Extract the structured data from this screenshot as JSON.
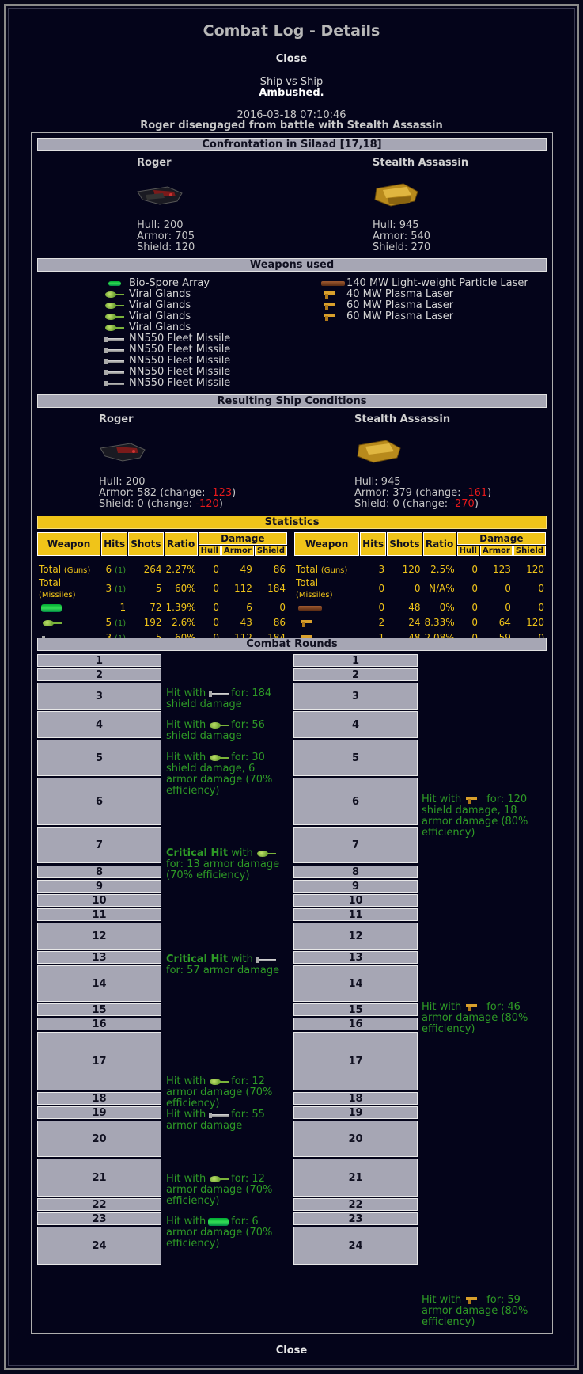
{
  "title": "Combat Log - Details",
  "close_label": "Close",
  "battle_type": "Ship vs Ship",
  "ambush": "Ambushed.",
  "date": "2016-03-18 07:10:46",
  "summary": "Roger disengaged from battle with Stealth Assassin",
  "confrontation": "Confrontation in Silaad [17,18]",
  "left": {
    "name": "Roger",
    "hull": "Hull: 200",
    "armor": "Armor: 705",
    "shield": "Shield: 120"
  },
  "right": {
    "name": "Stealth Assassin",
    "hull": "Hull: 945",
    "armor": "Armor: 540",
    "shield": "Shield: 270"
  },
  "weapons_title": "Weapons used",
  "left_weapons": [
    "Bio-Spore Array",
    "Viral Glands",
    "Viral Glands",
    "Viral Glands",
    "Viral Glands",
    "NN550 Fleet Missile",
    "NN550 Fleet Missile",
    "NN550 Fleet Missile",
    "NN550 Fleet Missile",
    "NN550 Fleet Missile"
  ],
  "right_weapons": [
    "140 MW Light-weight Particle Laser",
    "40 MW Plasma Laser",
    "60 MW Plasma Laser",
    "60 MW Plasma Laser"
  ],
  "result_title": "Resulting Ship Conditions",
  "left_result": {
    "name": "Roger",
    "hull": "Hull: 200",
    "armor_pre": "Armor: 582 (change: ",
    "armor_delta": "-123",
    "shield_pre": "Shield: 0 (change: ",
    "shield_delta": "-120",
    "close": ")"
  },
  "right_result": {
    "name": "Stealth Assassin",
    "hull": "Hull: 945",
    "armor_pre": "Armor: 379 (change: ",
    "armor_delta": "-161",
    "shield_pre": "Shield: 0 (change: ",
    "shield_delta": "-270",
    "close": ")"
  },
  "stats_title": "Statistics",
  "stat_headers": {
    "weapon": "Weapon",
    "hits": "Hits",
    "shots": "Shots",
    "ratio": "Ratio",
    "damage": "Damage",
    "hull": "Hull",
    "armor": "Armor",
    "shield": "Shield"
  },
  "stat_labels": {
    "total": "Total",
    "guns": "(Guns)",
    "missiles": "(Missiles)"
  },
  "left_stats": [
    [
      "6",
      "(1)",
      "264",
      "2.27%",
      "0",
      "49",
      "86"
    ],
    [
      "3",
      "(1)",
      "5",
      "60%",
      "0",
      "112",
      "184"
    ],
    [
      "1",
      "",
      "72",
      "1.39%",
      "0",
      "6",
      "0"
    ],
    [
      "5",
      "(1)",
      "192",
      "2.6%",
      "0",
      "43",
      "86"
    ],
    [
      "3",
      "(1)",
      "5",
      "60%",
      "0",
      "112",
      "184"
    ]
  ],
  "right_stats": [
    [
      "3",
      "",
      "120",
      "2.5%",
      "0",
      "123",
      "120"
    ],
    [
      "0",
      "",
      "0",
      "N/A%",
      "0",
      "0",
      "0"
    ],
    [
      "0",
      "",
      "48",
      "0%",
      "0",
      "0",
      "0"
    ],
    [
      "2",
      "",
      "24",
      "8.33%",
      "0",
      "64",
      "120"
    ],
    [
      "1",
      "",
      "48",
      "2.08%",
      "0",
      "59",
      "0"
    ]
  ],
  "rounds_title": "Combat Rounds",
  "rounds": [
    "1",
    "2",
    "3",
    "4",
    "5",
    "6",
    "7",
    "8",
    "9",
    "10",
    "11",
    "12",
    "13",
    "14",
    "15",
    "16",
    "17",
    "18",
    "19",
    "20",
    "21",
    "22",
    "23",
    "24"
  ],
  "left_msgs": {
    "3": [
      "Hit with",
      "for: 184 shield damage"
    ],
    "4": [
      "Hit with",
      "for: 56 shield damage"
    ],
    "5": [
      "Hit with",
      "for: 30 shield damage, 6 armor damage (70% efficiency)"
    ],
    "7": [
      "Critical Hit",
      "with",
      "for: 13 armor damage (70% efficiency)"
    ],
    "12": [
      "Critical Hit",
      "with",
      "for: 57 armor damage"
    ],
    "17a": [
      "Hit with",
      "for: 12 armor damage (70% efficiency)"
    ],
    "17b": [
      "Hit with",
      "for: 55 armor damage"
    ],
    "20": [
      "Hit with",
      "for: 12 armor damage (70% efficiency)"
    ],
    "21": [
      "Hit with",
      "for: 6 armor damage (70% efficiency)"
    ]
  },
  "right_msgs": {
    "6": [
      "Hit with",
      "for: 120 shield damage, 18 armor damage (80% efficiency)"
    ],
    "14": [
      "Hit with",
      "for: 46 armor damage (80% efficiency)"
    ],
    "24": [
      "Hit with",
      "for: 59 armor damage (80% efficiency)"
    ]
  }
}
